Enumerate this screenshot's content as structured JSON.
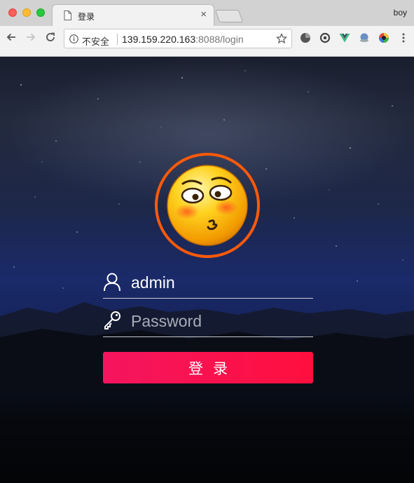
{
  "browser": {
    "tab_title": "登录",
    "tab_close": "×",
    "profile_name": "boy",
    "security_label": "不安全",
    "url_host": "139.159.220.163",
    "url_rest": ":8088/login"
  },
  "login": {
    "username_value": "admin",
    "password_placeholder": "Password",
    "submit_label": "登录"
  },
  "colors": {
    "accent": "#ff0f3e",
    "avatar_ring": "#ff5a0a"
  },
  "icons": {
    "back": "arrow-left-icon",
    "forward": "arrow-right-icon",
    "reload": "reload-icon",
    "info": "info-icon",
    "bookmark": "star-icon",
    "user": "user-icon",
    "key": "key-icon",
    "avatar": "emoji-avatar"
  }
}
